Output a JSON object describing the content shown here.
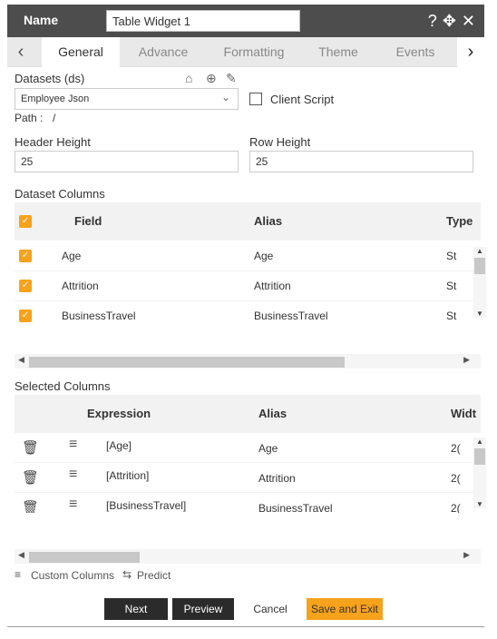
{
  "titlebar": {
    "name_label": "Name",
    "name_value": "Table Widget 1",
    "icons": [
      "help-icon",
      "move-icon",
      "close-icon"
    ]
  },
  "tabs": {
    "items": [
      "General",
      "Advance",
      "Formatting",
      "Theme",
      "Events"
    ],
    "active": "General"
  },
  "datasets": {
    "label": "Datasets (ds)",
    "selected": "Employee Json",
    "client_script_label": "Client Script",
    "path_label": "Path :",
    "path_value": "/"
  },
  "heights": {
    "header_label": "Header Height",
    "header_value": "25",
    "row_label": "Row Height",
    "row_value": "25"
  },
  "dataset_columns": {
    "title": "Dataset Columns",
    "headers": {
      "field": "Field",
      "alias": "Alias",
      "type": "Type"
    },
    "rows": [
      {
        "field": "Age",
        "alias": "Age",
        "type": "St"
      },
      {
        "field": "Attrition",
        "alias": "Attrition",
        "type": "St"
      },
      {
        "field": "BusinessTravel",
        "alias": "BusinessTravel",
        "type": "St"
      }
    ]
  },
  "selected_columns": {
    "title": "Selected Columns",
    "headers": {
      "expression": "Expression",
      "alias": "Alias",
      "width": "Widt"
    },
    "rows": [
      {
        "expression": "[Age]",
        "alias": "Age",
        "width": "2("
      },
      {
        "expression": "[Attrition]",
        "alias": "Attrition",
        "width": "2("
      },
      {
        "expression": "[BusinessTravel]",
        "alias": "BusinessTravel",
        "width": "2("
      }
    ]
  },
  "links": {
    "custom_columns": "Custom Columns",
    "predict": "Predict"
  },
  "buttons": {
    "next": "Next",
    "preview": "Preview",
    "cancel": "Cancel",
    "save_exit": "Save and Exit"
  },
  "colors": {
    "accent": "#f7a21b",
    "titlebar": "#4d4d4d",
    "dark_button": "#2b2b2b"
  }
}
